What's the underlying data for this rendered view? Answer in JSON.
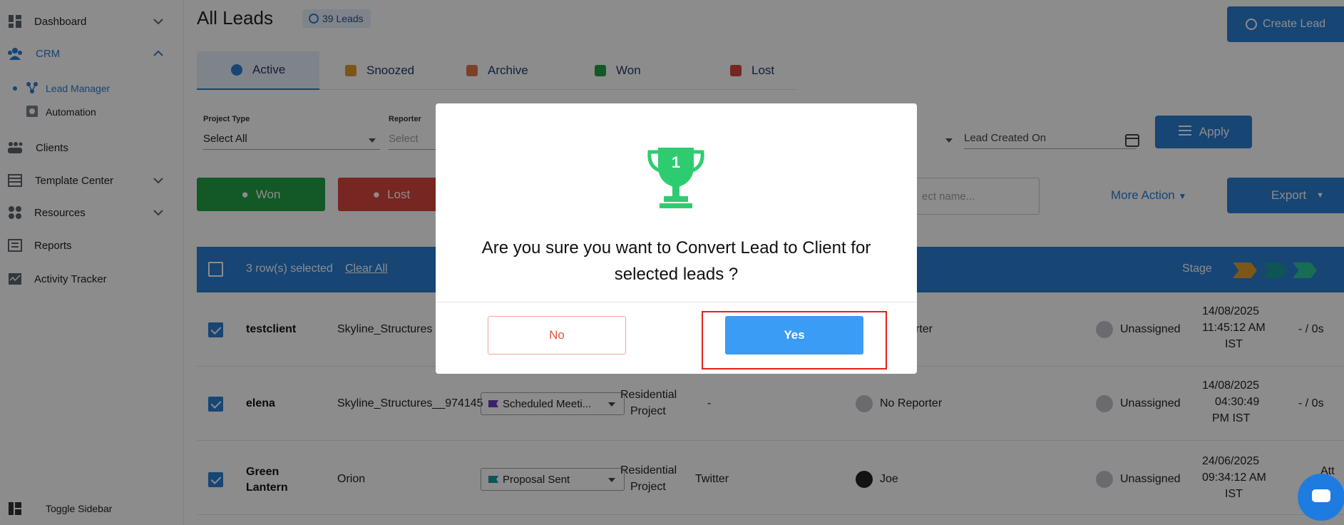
{
  "sidebar": {
    "items": [
      {
        "label": "Dashboard",
        "icon": "dashboard-icon"
      },
      {
        "label": "CRM",
        "icon": "crm-icon"
      },
      {
        "label": "Clients",
        "icon": "clients-icon"
      },
      {
        "label": "Template Center",
        "icon": "template-icon"
      },
      {
        "label": "Resources",
        "icon": "resources-icon"
      },
      {
        "label": "Reports",
        "icon": "reports-icon"
      },
      {
        "label": "Activity Tracker",
        "icon": "activity-icon"
      }
    ],
    "sub_items": [
      {
        "label": "Lead Manager",
        "icon": "lead-manager-icon"
      },
      {
        "label": "Automation",
        "icon": "automation-icon"
      }
    ],
    "toggle": "Toggle Sidebar"
  },
  "header": {
    "title": "All Leads",
    "lead_count": "39 Leads",
    "create_button": "Create Lead"
  },
  "tabs": [
    "Active",
    "Snoozed",
    "Archive",
    "Won",
    "Lost"
  ],
  "filters": {
    "project_type_label": "Project Type",
    "project_type_value": "Select All",
    "reporter_label": "Reporter",
    "reporter_placeholder": "Select",
    "lead_created_label": "Lead Created On",
    "apply": "Apply"
  },
  "actions": {
    "won": "Won",
    "lost": "Lost",
    "search_placeholder": "ect name...",
    "more_action": "More Action",
    "export": "Export"
  },
  "table": {
    "selected_text": "3 row(s) selected",
    "clear_all": "Clear All",
    "stage_label": "Stage",
    "rows": [
      {
        "name": "testclient",
        "project": "Skyline_Structures",
        "stage": "",
        "type_line1": "",
        "type_line2": "",
        "source": "",
        "reporter": "rter",
        "assignee": "Unassigned",
        "date1": "14/08/2025",
        "date2": "11:45:12 AM",
        "date3": "IST",
        "tail": "- / 0s"
      },
      {
        "name": "elena",
        "project": "Skyline_Structures__974145",
        "stage": "Scheduled Meeti...",
        "type_line1": "Residential",
        "type_line2": "Project",
        "source": "-",
        "reporter": "No Reporter",
        "assignee": "Unassigned",
        "date1": "14/08/2025",
        "date2": "04:30:49",
        "date3": "PM IST",
        "tail": "- / 0s"
      },
      {
        "name": "Green Lantern",
        "project": "Orion",
        "stage": "Proposal Sent",
        "type_line1": "Residential",
        "type_line2": "Project",
        "source": "Twitter",
        "reporter": "Joe",
        "assignee": "Unassigned",
        "date1": "24/06/2025",
        "date2": "09:34:12 AM",
        "date3": "IST",
        "tail": "Att"
      }
    ]
  },
  "modal": {
    "badge_number": "1",
    "message": "Are you sure you want to Convert Lead to Client for selected leads ?",
    "no": "No",
    "yes": "Yes"
  },
  "colors": {
    "primary": "#2a7fd4",
    "won": "#23a047",
    "lost": "#d9453f",
    "trophy": "#2ecc71",
    "yes": "#3b9cf5",
    "highlight": "#e3211c"
  }
}
